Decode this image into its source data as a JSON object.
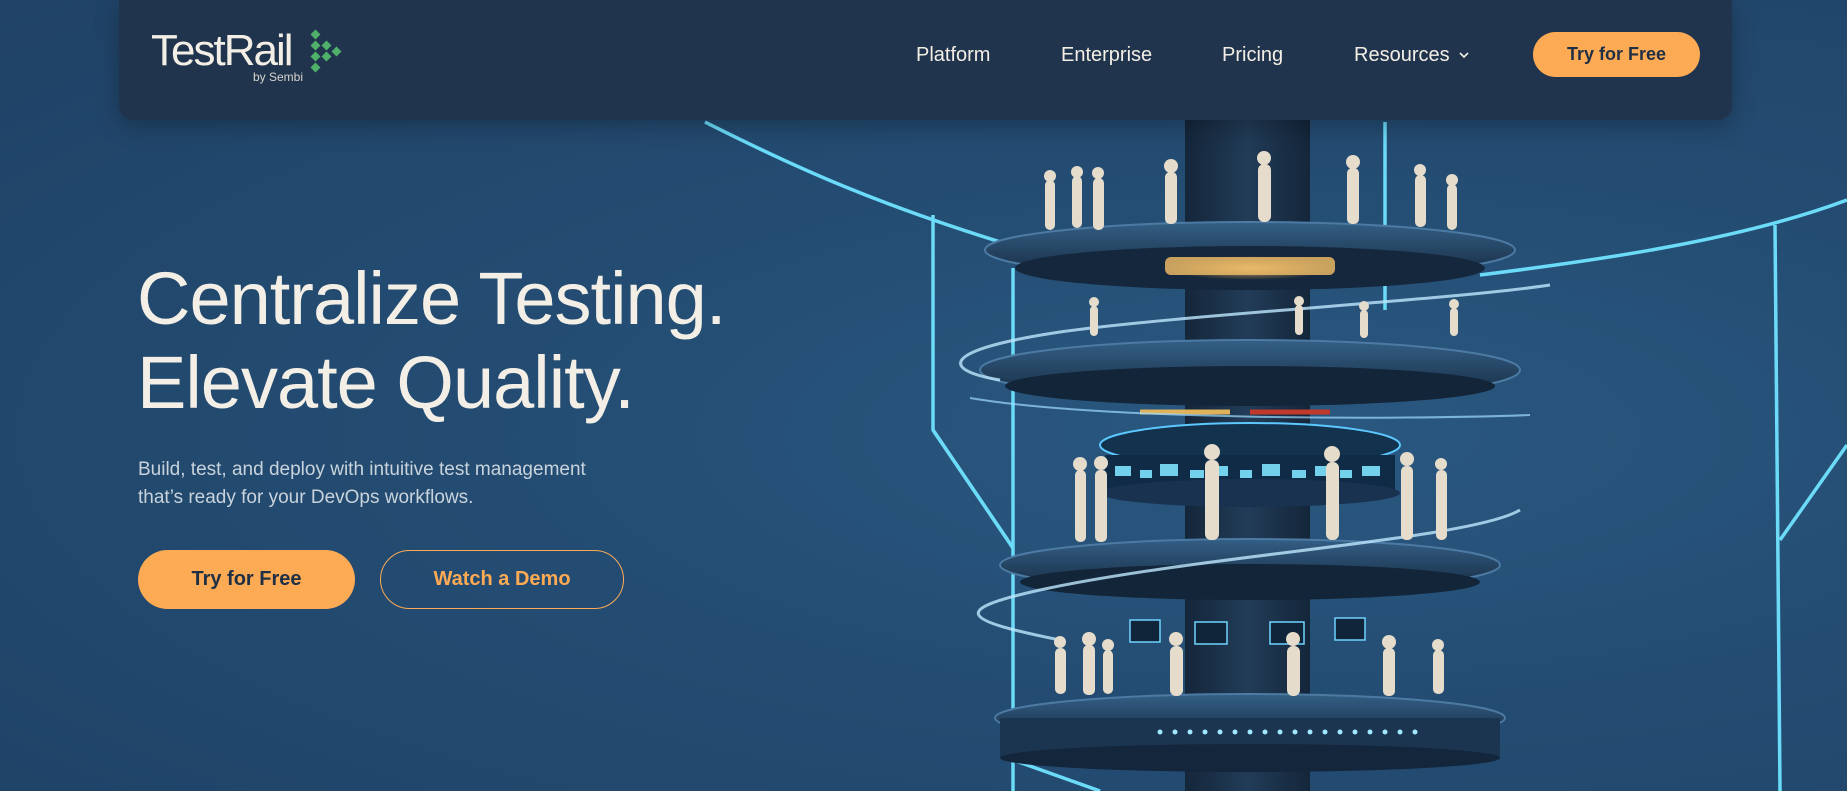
{
  "brand": {
    "name": "TestRail",
    "byline": "by Sembi",
    "accent": "#fdaa55",
    "logo_green": "#4fb06a",
    "nav_bg": "#21344d",
    "page_bg": "#244c72"
  },
  "nav": {
    "items": [
      {
        "label": "Platform"
      },
      {
        "label": "Enterprise"
      },
      {
        "label": "Pricing"
      },
      {
        "label": "Resources",
        "icon": "chevron-down-icon"
      }
    ],
    "cta_label": "Try for Free"
  },
  "hero": {
    "title_line1": "Centralize Testing.",
    "title_line2": "Elevate Quality.",
    "subtitle_line1": "Build, test, and deploy with intuitive test management",
    "subtitle_line2": "that’s ready for your DevOps workflows.",
    "primary_cta": "Try for Free",
    "secondary_cta": "Watch a Demo"
  }
}
